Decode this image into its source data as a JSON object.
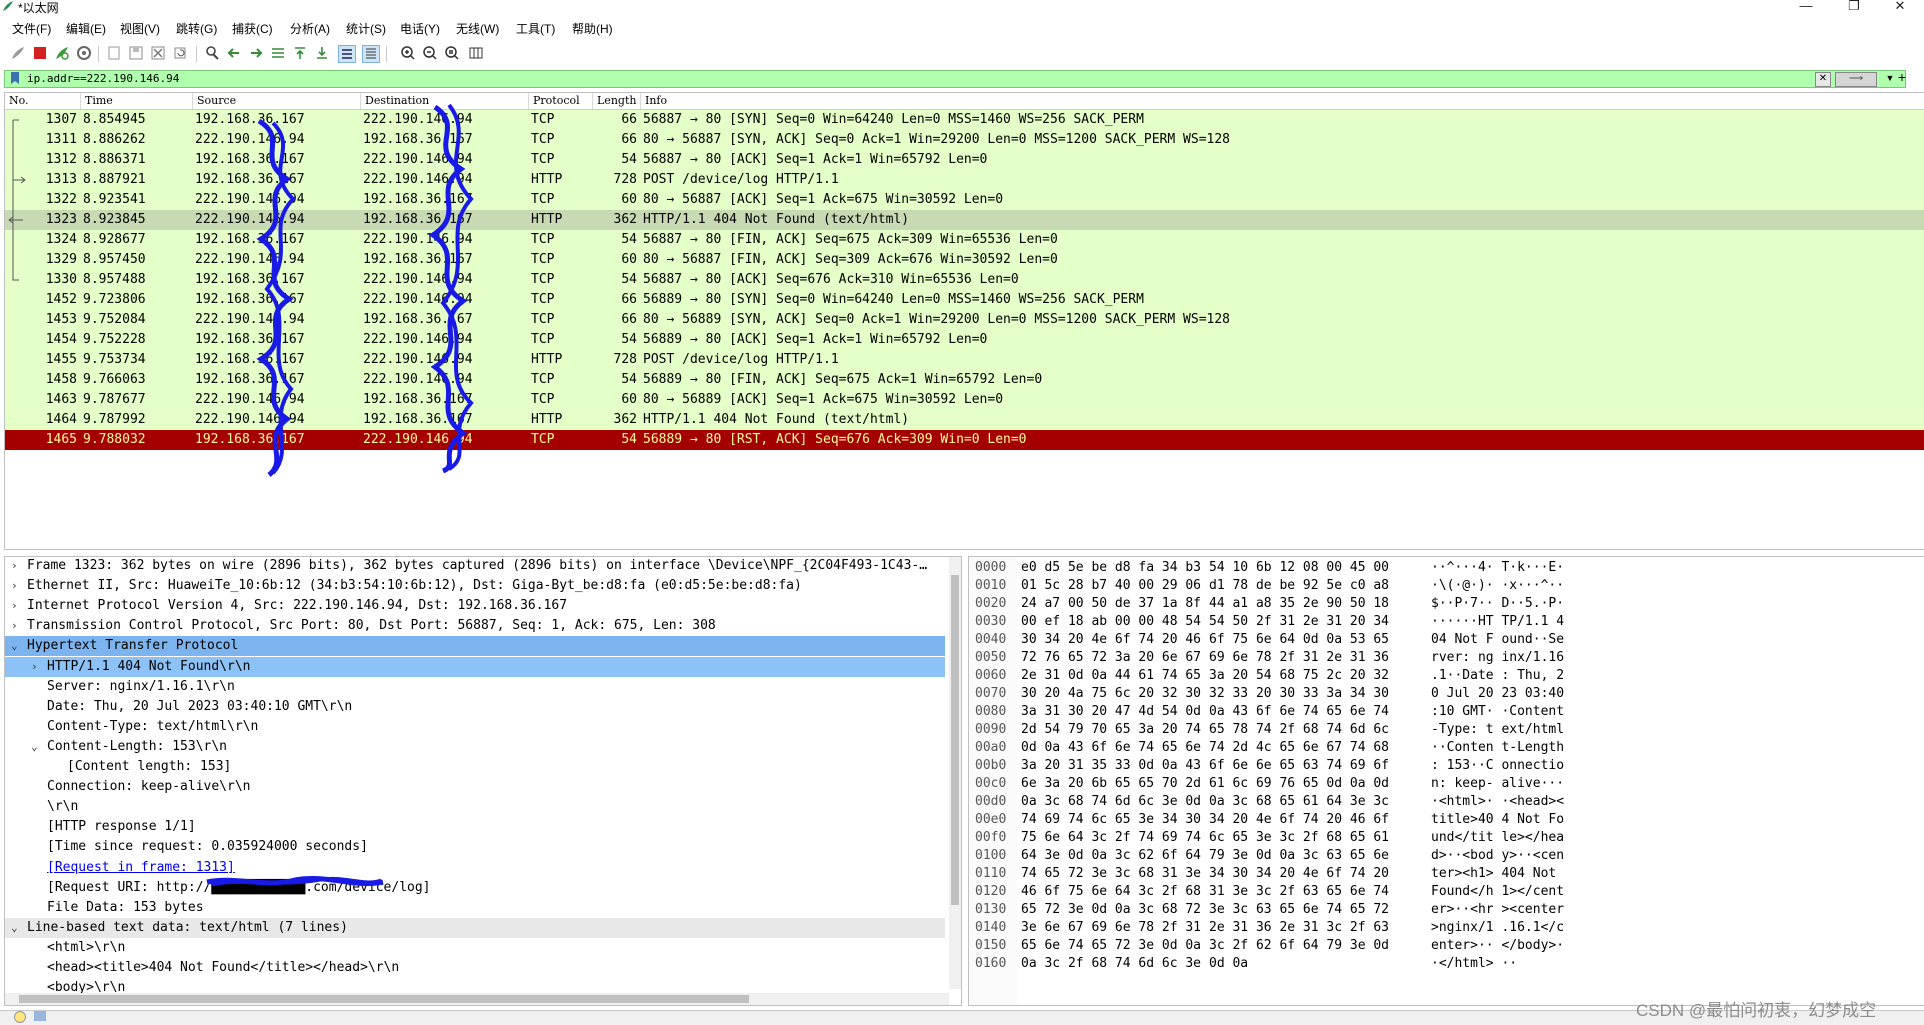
{
  "window": {
    "title": "*以太网",
    "controls": {
      "minimize": "—",
      "maximize": "❐",
      "close": "✕"
    }
  },
  "menu": [
    "文件(F)",
    "编辑(E)",
    "视图(V)",
    "跳转(G)",
    "捕获(C)",
    "分析(A)",
    "统计(S)",
    "电话(Y)",
    "无线(W)",
    "工具(T)",
    "帮助(H)"
  ],
  "filter": {
    "value": "ip.addr==222.190.146.94",
    "clear_icon": "close-icon",
    "apply_icon": "arrow-right-icon",
    "add": "+"
  },
  "columns": [
    "No.",
    "Time",
    "Source",
    "Destination",
    "Protocol",
    "Length",
    "Info"
  ],
  "packets": [
    {
      "no": "1307",
      "time": "8.854945",
      "src": "192.168.36.167",
      "dst": "222.190.146.94",
      "proto": "TCP",
      "len": "66",
      "info": "56887 → 80 [SYN] Seq=0 Win=64240 Len=0 MSS=1460 WS=256 SACK_PERM",
      "style": "normal",
      "mark": "start"
    },
    {
      "no": "1311",
      "time": "8.886262",
      "src": "222.190.146.94",
      "dst": "192.168.36.167",
      "proto": "TCP",
      "len": "66",
      "info": "80 → 56887 [SYN, ACK] Seq=0 Ack=1 Win=29200 Len=0 MSS=1200 SACK_PERM WS=128",
      "style": "normal",
      "mark": "line"
    },
    {
      "no": "1312",
      "time": "8.886371",
      "src": "192.168.36.167",
      "dst": "222.190.146.94",
      "proto": "TCP",
      "len": "54",
      "info": "56887 → 80 [ACK] Seq=1 Ack=1 Win=65792 Len=0",
      "style": "normal",
      "mark": "line"
    },
    {
      "no": "1313",
      "time": "8.887921",
      "src": "192.168.36.167",
      "dst": "222.190.146.94",
      "proto": "HTTP",
      "len": "728",
      "info": "POST /device/log HTTP/1.1",
      "style": "normal",
      "mark": "req"
    },
    {
      "no": "1322",
      "time": "8.923541",
      "src": "222.190.146.94",
      "dst": "192.168.36.167",
      "proto": "TCP",
      "len": "60",
      "info": "80 → 56887 [ACK] Seq=1 Ack=675 Win=30592 Len=0",
      "style": "normal",
      "mark": "line"
    },
    {
      "no": "1323",
      "time": "8.923845",
      "src": "222.190.146.94",
      "dst": "192.168.36.167",
      "proto": "HTTP",
      "len": "362",
      "info": "HTTP/1.1 404 Not Found  (text/html)",
      "style": "selected",
      "mark": "resp"
    },
    {
      "no": "1324",
      "time": "8.928677",
      "src": "192.168.36.167",
      "dst": "222.190.146.94",
      "proto": "TCP",
      "len": "54",
      "info": "56887 → 80 [FIN, ACK] Seq=675 Ack=309 Win=65536 Len=0",
      "style": "normal",
      "mark": "line"
    },
    {
      "no": "1329",
      "time": "8.957450",
      "src": "222.190.146.94",
      "dst": "192.168.36.167",
      "proto": "TCP",
      "len": "60",
      "info": "80 → 56887 [FIN, ACK] Seq=309 Ack=676 Win=30592 Len=0",
      "style": "normal",
      "mark": "line"
    },
    {
      "no": "1330",
      "time": "8.957488",
      "src": "192.168.36.167",
      "dst": "222.190.146.94",
      "proto": "TCP",
      "len": "54",
      "info": "56887 → 80 [ACK] Seq=676 Ack=310 Win=65536 Len=0",
      "style": "normal",
      "mark": "end"
    },
    {
      "no": "1452",
      "time": "9.723806",
      "src": "192.168.36.167",
      "dst": "222.190.146.94",
      "proto": "TCP",
      "len": "66",
      "info": "56889 → 80 [SYN] Seq=0 Win=64240 Len=0 MSS=1460 WS=256 SACK_PERM",
      "style": "normal",
      "mark": ""
    },
    {
      "no": "1453",
      "time": "9.752084",
      "src": "222.190.146.94",
      "dst": "192.168.36.167",
      "proto": "TCP",
      "len": "66",
      "info": "80 → 56889 [SYN, ACK] Seq=0 Ack=1 Win=29200 Len=0 MSS=1200 SACK_PERM WS=128",
      "style": "normal",
      "mark": ""
    },
    {
      "no": "1454",
      "time": "9.752228",
      "src": "192.168.36.167",
      "dst": "222.190.146.94",
      "proto": "TCP",
      "len": "54",
      "info": "56889 → 80 [ACK] Seq=1 Ack=1 Win=65792 Len=0",
      "style": "normal",
      "mark": ""
    },
    {
      "no": "1455",
      "time": "9.753734",
      "src": "192.168.36.167",
      "dst": "222.190.146.94",
      "proto": "HTTP",
      "len": "728",
      "info": "POST /device/log HTTP/1.1",
      "style": "normal",
      "mark": ""
    },
    {
      "no": "1458",
      "time": "9.766063",
      "src": "192.168.36.167",
      "dst": "222.190.146.94",
      "proto": "TCP",
      "len": "54",
      "info": "56889 → 80 [FIN, ACK] Seq=675 Ack=1 Win=65792 Len=0",
      "style": "normal",
      "mark": ""
    },
    {
      "no": "1463",
      "time": "9.787677",
      "src": "222.190.146.94",
      "dst": "192.168.36.167",
      "proto": "TCP",
      "len": "60",
      "info": "80 → 56889 [ACK] Seq=1 Ack=675 Win=30592 Len=0",
      "style": "normal",
      "mark": ""
    },
    {
      "no": "1464",
      "time": "9.787992",
      "src": "222.190.146.94",
      "dst": "192.168.36.167",
      "proto": "HTTP",
      "len": "362",
      "info": "HTTP/1.1 404 Not Found  (text/html)",
      "style": "normal",
      "mark": ""
    },
    {
      "no": "1465",
      "time": "9.788032",
      "src": "192.168.36.167",
      "dst": "222.190.146.94",
      "proto": "TCP",
      "len": "54",
      "info": "56889 → 80 [RST, ACK] Seq=676 Ack=309 Win=0 Len=0",
      "style": "reset",
      "mark": ""
    }
  ],
  "details": [
    {
      "text": "Frame 1323: 362 bytes on wire (2896 bits), 362 bytes captured (2896 bits) on interface \\Device\\NPF_{2C04F493-1C43-…",
      "indent": 0,
      "arrow": "›",
      "style": ""
    },
    {
      "text": "Ethernet II, Src: HuaweiTe_10:6b:12 (34:b3:54:10:6b:12), Dst: Giga-Byt_be:d8:fa (e0:d5:5e:be:d8:fa)",
      "indent": 0,
      "arrow": "›",
      "style": ""
    },
    {
      "text": "Internet Protocol Version 4, Src: 222.190.146.94, Dst: 192.168.36.167",
      "indent": 0,
      "arrow": "›",
      "style": ""
    },
    {
      "text": "Transmission Control Protocol, Src Port: 80, Dst Port: 56887, Seq: 1, Ack: 675, Len: 308",
      "indent": 0,
      "arrow": "›",
      "style": ""
    },
    {
      "text": "Hypertext Transfer Protocol",
      "indent": 0,
      "arrow": "⌄",
      "style": "selrow"
    },
    {
      "text": "HTTP/1.1 404 Not Found\\r\\n",
      "indent": 1,
      "arrow": "›",
      "style": "selsub"
    },
    {
      "text": "Server: nginx/1.16.1\\r\\n",
      "indent": 1,
      "arrow": "",
      "style": ""
    },
    {
      "text": "Date: Thu, 20 Jul 2023 03:40:10 GMT\\r\\n",
      "indent": 1,
      "arrow": "",
      "style": ""
    },
    {
      "text": "Content-Type: text/html\\r\\n",
      "indent": 1,
      "arrow": "",
      "style": ""
    },
    {
      "text": "Content-Length: 153\\r\\n",
      "indent": 1,
      "arrow": "⌄",
      "style": ""
    },
    {
      "text": "[Content length: 153]",
      "indent": 2,
      "arrow": "",
      "style": ""
    },
    {
      "text": "Connection: keep-alive\\r\\n",
      "indent": 1,
      "arrow": "",
      "style": ""
    },
    {
      "text": "\\r\\n",
      "indent": 1,
      "arrow": "",
      "style": ""
    },
    {
      "text": "[HTTP response 1/1]",
      "indent": 1,
      "arrow": "",
      "style": ""
    },
    {
      "text": "[Time since request: 0.035924000 seconds]",
      "indent": 1,
      "arrow": "",
      "style": ""
    },
    {
      "text": "[Request in frame: 1313]",
      "indent": 1,
      "arrow": "",
      "style": "link"
    },
    {
      "text": "[Request URI: http://████████████.com/device/log]",
      "indent": 1,
      "arrow": "",
      "style": ""
    },
    {
      "text": "File Data: 153 bytes",
      "indent": 1,
      "arrow": "",
      "style": ""
    },
    {
      "text": "Line-based text data: text/html (7 lines)",
      "indent": 0,
      "arrow": "⌄",
      "style": "hl"
    },
    {
      "text": "<html>\\r\\n",
      "indent": 1,
      "arrow": "",
      "style": ""
    },
    {
      "text": "<head><title>404 Not Found</title></head>\\r\\n",
      "indent": 1,
      "arrow": "",
      "style": ""
    },
    {
      "text": "<body>\\r\\n",
      "indent": 1,
      "arrow": "",
      "style": ""
    }
  ],
  "bytes": [
    {
      "off": "0000",
      "hex1": "e0 d5 5e be d8 fa 34 b3",
      "hex2": "54 10 6b 12 08 00 45 00",
      "ascii": "··^···4· T·k···E·"
    },
    {
      "off": "0010",
      "hex1": "01 5c 28 b7 40 00 29 06",
      "hex2": "d1 78 de be 92 5e c0 a8",
      "ascii": "·\\(·@·)· ·x···^··"
    },
    {
      "off": "0020",
      "hex1": "24 a7 00 50 de 37 1a 8f",
      "hex2": "44 a1 a8 35 2e 90 50 18",
      "ascii": "$··P·7·· D··5.·P·"
    },
    {
      "off": "0030",
      "hex1": "00 ef 18 ab 00 00 48 54",
      "hex2": "54 50 2f 31 2e 31 20 34",
      "ascii": "······HT TP/1.1 4"
    },
    {
      "off": "0040",
      "hex1": "30 34 20 4e 6f 74 20 46",
      "hex2": "6f 75 6e 64 0d 0a 53 65",
      "ascii": "04 Not F ound··Se"
    },
    {
      "off": "0050",
      "hex1": "72 76 65 72 3a 20 6e 67",
      "hex2": "69 6e 78 2f 31 2e 31 36",
      "ascii": "rver: ng inx/1.16"
    },
    {
      "off": "0060",
      "hex1": "2e 31 0d 0a 44 61 74 65",
      "hex2": "3a 20 54 68 75 2c 20 32",
      "ascii": ".1··Date : Thu, 2"
    },
    {
      "off": "0070",
      "hex1": "30 20 4a 75 6c 20 32 30",
      "hex2": "32 33 20 30 33 3a 34 30",
      "ascii": "0 Jul 20 23 03:40"
    },
    {
      "off": "0080",
      "hex1": "3a 31 30 20 47 4d 54 0d",
      "hex2": "0a 43 6f 6e 74 65 6e 74",
      "ascii": ":10 GMT· ·Content"
    },
    {
      "off": "0090",
      "hex1": "2d 54 79 70 65 3a 20 74",
      "hex2": "65 78 74 2f 68 74 6d 6c",
      "ascii": "-Type: t ext/html"
    },
    {
      "off": "00a0",
      "hex1": "0d 0a 43 6f 6e 74 65 6e",
      "hex2": "74 2d 4c 65 6e 67 74 68",
      "ascii": "··Conten t-Length"
    },
    {
      "off": "00b0",
      "hex1": "3a 20 31 35 33 0d 0a 43",
      "hex2": "6f 6e 6e 65 63 74 69 6f",
      "ascii": ": 153··C onnectio"
    },
    {
      "off": "00c0",
      "hex1": "6e 3a 20 6b 65 65 70 2d",
      "hex2": "61 6c 69 76 65 0d 0a 0d",
      "ascii": "n: keep- alive···"
    },
    {
      "off": "00d0",
      "hex1": "0a 3c 68 74 6d 6c 3e 0d",
      "hex2": "0a 3c 68 65 61 64 3e 3c",
      "ascii": "·<html>· ·<head><"
    },
    {
      "off": "00e0",
      "hex1": "74 69 74 6c 65 3e 34 30",
      "hex2": "34 20 4e 6f 74 20 46 6f",
      "ascii": "title>40 4 Not Fo"
    },
    {
      "off": "00f0",
      "hex1": "75 6e 64 3c 2f 74 69 74",
      "hex2": "6c 65 3e 3c 2f 68 65 61",
      "ascii": "und</tit le></hea"
    },
    {
      "off": "0100",
      "hex1": "64 3e 0d 0a 3c 62 6f 64",
      "hex2": "79 3e 0d 0a 3c 63 65 6e",
      "ascii": "d>··<bod y>··<cen"
    },
    {
      "off": "0110",
      "hex1": "74 65 72 3e 3c 68 31 3e",
      "hex2": "34 30 34 20 4e 6f 74 20",
      "ascii": "ter><h1> 404 Not "
    },
    {
      "off": "0120",
      "hex1": "46 6f 75 6e 64 3c 2f 68",
      "hex2": "31 3e 3c 2f 63 65 6e 74",
      "ascii": "Found</h 1></cent"
    },
    {
      "off": "0130",
      "hex1": "65 72 3e 0d 0a 3c 68 72",
      "hex2": "3e 3c 63 65 6e 74 65 72",
      "ascii": "er>··<hr ><center"
    },
    {
      "off": "0140",
      "hex1": "3e 6e 67 69 6e 78 2f 31",
      "hex2": "2e 31 36 2e 31 3c 2f 63",
      "ascii": ">nginx/1 .16.1</c"
    },
    {
      "off": "0150",
      "hex1": "65 6e 74 65 72 3e 0d 0a",
      "hex2": "3c 2f 62 6f 64 79 3e 0d",
      "ascii": "enter>·· </body>·"
    },
    {
      "off": "0160",
      "hex1": "0a 3c 2f 68 74 6d 6c 3e",
      "hex2": "0d 0a",
      "ascii": "·</html> ··"
    }
  ],
  "watermark": "CSDN @最怕问初衷，幻梦成空",
  "colors": {
    "row_bg": "#e4ffc7",
    "row_selected": "#c8dab4",
    "row_reset": "#a40000",
    "filter_bg": "#afffaf",
    "tree_selected": "#7cb4f0"
  }
}
